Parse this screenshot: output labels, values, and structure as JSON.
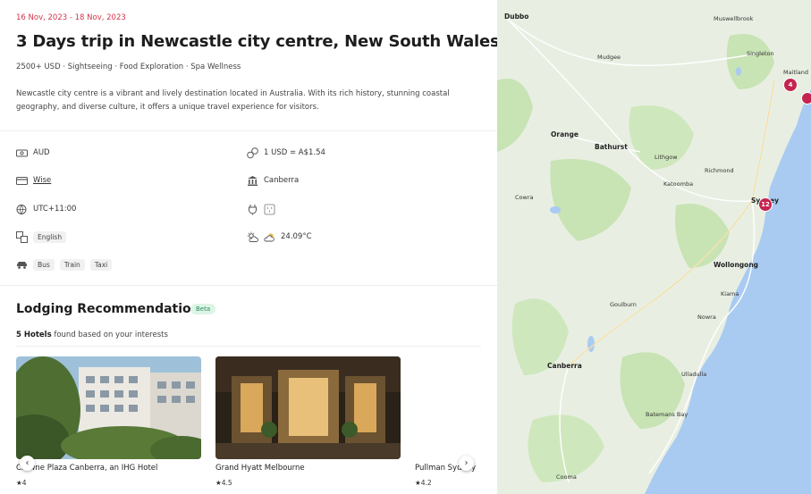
{
  "trip": {
    "dates": "16 Nov, 2023 - 18 Nov, 2023",
    "title": "3 Days trip in Newcastle city centre, New South Wales,...",
    "tags": "2500+ USD · Sightseeing · Food Exploration · Spa Wellness",
    "description": "Newcastle city centre is a vibrant and lively destination located in Australia. With its rich history, stunning coastal geography, and diverse culture, it offers a unique travel experience for visitors."
  },
  "info": {
    "currency": "AUD",
    "exchange": "1 USD = A$1.54",
    "payment": "Wise",
    "capital": "Canberra",
    "timezone": "UTC+11:00",
    "language": "English",
    "temperature": "24.09°C",
    "transport": [
      "Bus",
      "Train",
      "Taxi"
    ]
  },
  "lodging": {
    "title": "Lodging Recommendation",
    "badge": "Beta",
    "count_bold": "5 Hotels",
    "count_rest": " found based on your interests",
    "hotels": [
      {
        "name": "Crowne Plaza Canberra, an IHG Hotel",
        "rating": "★4"
      },
      {
        "name": "Grand Hyatt Melbourne",
        "rating": "★4.5"
      },
      {
        "name": "Pullman Sydney",
        "rating": "★4.2"
      }
    ]
  },
  "map": {
    "labels": [
      "Dubbo",
      "Muswellbrook",
      "Mudgee",
      "Singleton",
      "Maitland",
      "Orange",
      "Bathurst",
      "Lithgow",
      "Richmond",
      "Katoomba",
      "Cowra",
      "Sydney",
      "Wollongong",
      "Kiama",
      "Goulburn",
      "Nowra",
      "Canberra",
      "Ulladulla",
      "Batemans Bay",
      "Cooma"
    ],
    "clusters": [
      "4",
      "12"
    ],
    "colors": {
      "water": "#a9cbf2",
      "land": "#e8efe2",
      "park": "#c8e3b4",
      "cluster": "#c4244f"
    }
  },
  "colors": {
    "accent": "#d2334b",
    "badge_bg": "#dbf5e6",
    "badge_text": "#2a8b59"
  }
}
